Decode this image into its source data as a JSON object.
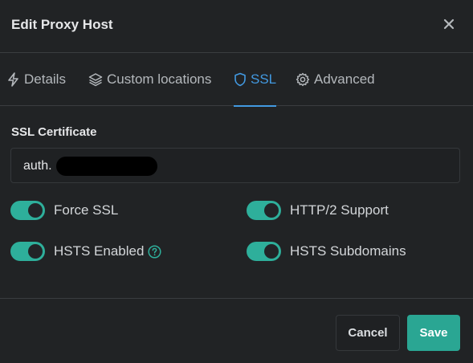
{
  "modal": {
    "title": "Edit Proxy Host"
  },
  "tabs": [
    {
      "label": "Details",
      "icon": "lightning-icon"
    },
    {
      "label": "Custom locations",
      "icon": "layers-icon"
    },
    {
      "label": "SSL",
      "icon": "shield-icon",
      "active": true
    },
    {
      "label": "Advanced",
      "icon": "gear-icon"
    }
  ],
  "ssl": {
    "certificate_label": "SSL Certificate",
    "certificate_value": "auth."
  },
  "switches": {
    "force_ssl": {
      "label": "Force SSL",
      "on": true
    },
    "http2": {
      "label": "HTTP/2 Support",
      "on": true
    },
    "hsts": {
      "label": "HSTS Enabled",
      "on": true
    },
    "hsts_subdomains": {
      "label": "HSTS Subdomains",
      "on": true
    }
  },
  "footer": {
    "cancel_label": "Cancel",
    "save_label": "Save"
  },
  "colors": {
    "accent": "#4299e1",
    "toggle_on": "#2eaf9b",
    "save": "#2aa693",
    "background": "#212325"
  }
}
